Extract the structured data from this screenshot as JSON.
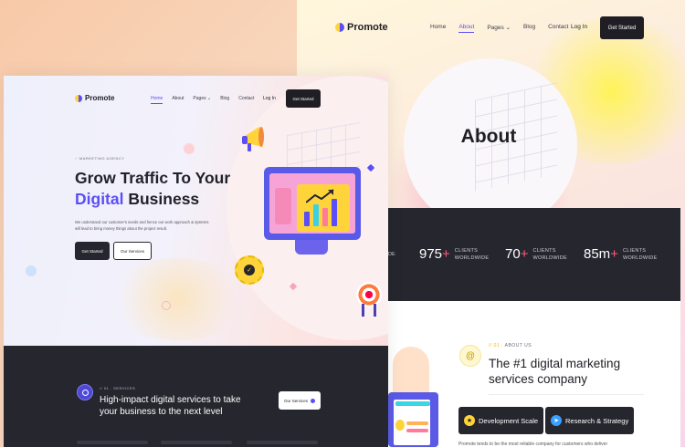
{
  "about_page": {
    "brand": "Promote",
    "nav": [
      "Home",
      "About",
      "Pages",
      "Blog",
      "Contact"
    ],
    "active_nav": "About",
    "pages_chevron": "⌄",
    "login": "Log In",
    "cta": "Get Started",
    "title": "About",
    "stats": [
      {
        "value": "975",
        "suffix": "+",
        "label_line1": "CLIENTS",
        "label_line2": "WORLDWIDE"
      },
      {
        "value": "70",
        "suffix": "+",
        "label_line1": "CLIENTS",
        "label_line2": "WORLDWIDE"
      },
      {
        "value": "85m",
        "suffix": "+",
        "label_line1": "CLIENTS",
        "label_line2": "WORLDWIDE"
      }
    ],
    "stat_cutoff": "DE",
    "about_eyebrow_prefix": "// 01 .",
    "about_eyebrow": "ABOUT US",
    "about_icon": "@",
    "about_heading": "The #1 digital marketing services company",
    "tags": [
      {
        "icon": "badge-icon",
        "label": "Development Scale"
      },
      {
        "icon": "send-icon",
        "label": "Research & Strategy"
      }
    ],
    "paragraph": "Promote tends to be the most reliable company for customers who deliver"
  },
  "home_page": {
    "brand": "Promote",
    "nav": [
      "Home",
      "About",
      "Pages",
      "Blog",
      "Contact"
    ],
    "active_nav": "Home",
    "pages_chevron": "⌄",
    "login": "Log In",
    "cta": "Get Started",
    "eyebrow_prefix": "//",
    "eyebrow": "MARKETING AGENCY",
    "headline_line1": "Grow Traffic To Your",
    "headline_accent": "Digital",
    "headline_rest": " Business",
    "description": "We understand our customer's needs and hence our work approach & systems will lead to bring money things about the project result.",
    "primary_button": "Get Started",
    "secondary_button": "Our Services",
    "services_eyebrow": "// 01 . SERVICES",
    "services_heading": "High-impact digital services to take your business to the next level",
    "services_button": "Our Services"
  },
  "colors": {
    "accent": "#5b4ef5",
    "dark": "#26262e",
    "yellow": "#ffd43b",
    "pink_plus": "#ff5a7a"
  }
}
